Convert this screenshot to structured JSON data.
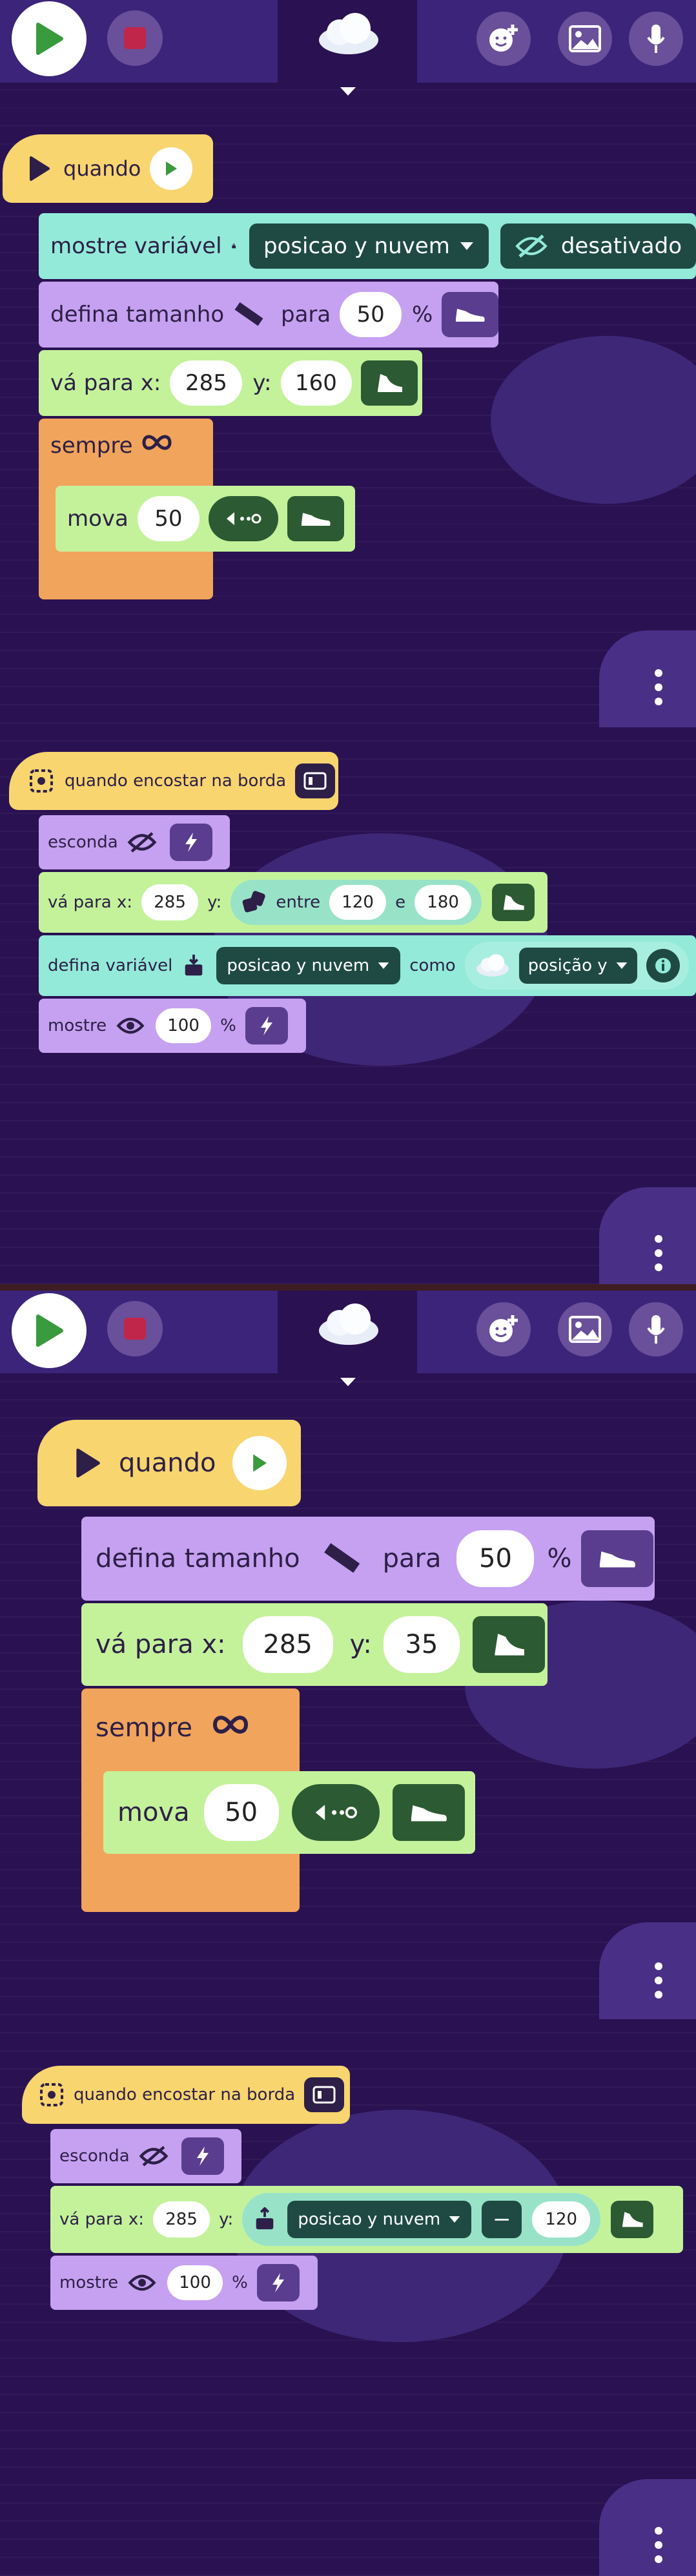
{
  "screen_a": {
    "script1": {
      "hat_label": "quando",
      "show_var": {
        "label": "mostre variável",
        "var": "posicao y nuvem",
        "state": "desativado"
      },
      "set_size": {
        "label": "defina tamanho",
        "para": "para",
        "value": "50",
        "unit": "%"
      },
      "goto": {
        "label": "vá para x:",
        "x": "285",
        "ylabel": "y:",
        "y": "160"
      },
      "forever": {
        "label": "sempre"
      },
      "move": {
        "label": "mova",
        "value": "50"
      }
    },
    "script2": {
      "hat_label": "quando encostar na borda",
      "hide": {
        "label": "esconda"
      },
      "goto": {
        "label": "vá para x:",
        "x": "285",
        "ylabel": "y:",
        "entre": "entre",
        "a": "120",
        "e": "e",
        "b": "180"
      },
      "setvar": {
        "label": "defina variável",
        "var": "posicao y nuvem",
        "como": "como",
        "source": "posição y"
      },
      "show": {
        "label": "mostre",
        "value": "100",
        "unit": "%"
      }
    }
  },
  "screen_b": {
    "script1": {
      "hat_label": "quando",
      "set_size": {
        "label": "defina tamanho",
        "para": "para",
        "value": "50",
        "unit": "%"
      },
      "goto": {
        "label": "vá para x:",
        "x": "285",
        "ylabel": "y:",
        "y": "35"
      },
      "forever": {
        "label": "sempre"
      },
      "move": {
        "label": "mova",
        "value": "50"
      }
    },
    "script2": {
      "hat_label": "quando encostar na borda",
      "hide": {
        "label": "esconda"
      },
      "goto": {
        "label": "vá para x:",
        "x": "285",
        "ylabel": "y:",
        "var": "posicao y nuvem",
        "op": "−",
        "value": "120"
      },
      "show": {
        "label": "mostre",
        "value": "100",
        "unit": "%"
      }
    }
  },
  "icons": [
    "play-icon",
    "stop-icon",
    "cloud-icon",
    "chevron-down-icon",
    "add-sprite-icon",
    "image-icon",
    "microphone-icon",
    "more-vert-icon",
    "flag-icon",
    "eye-off-icon",
    "eye-icon",
    "ruler-icon",
    "shoe-icon",
    "infinity-icon",
    "dice-icon",
    "variable-icon",
    "lightning-icon",
    "edge-icon",
    "info-icon",
    "arrow-left-icon"
  ],
  "colors": {
    "background": "#2a1152",
    "topbar": "#3b2479",
    "hat": "#f8d56f",
    "looks": "#c6a1f1",
    "motion": "#c4f29b",
    "control": "#f1a45b",
    "variables": "#93ead9",
    "run": "#3a9a3e",
    "stop": "#c0264a"
  }
}
